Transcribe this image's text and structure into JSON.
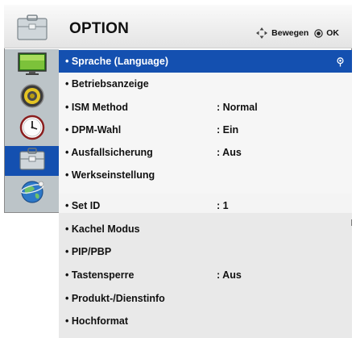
{
  "header": {
    "title": "OPTION",
    "move_label": "Bewegen",
    "ok_label": "OK"
  },
  "sidebar": {
    "items": [
      {
        "icon": "picture-icon",
        "active": false
      },
      {
        "icon": "speaker-icon",
        "active": false
      },
      {
        "icon": "clock-icon",
        "active": false
      },
      {
        "icon": "toolbox-icon",
        "active": true
      },
      {
        "icon": "network-globe-icon",
        "active": false
      }
    ]
  },
  "menu": {
    "items": [
      {
        "label": "• Sprache (Language)",
        "value": "",
        "selected": true
      },
      {
        "label": "• Betriebsanzeige",
        "value": ""
      },
      {
        "label": "• ISM Method",
        "value": ": Normal"
      },
      {
        "label": "• DPM-Wahl",
        "value": ": Ein"
      },
      {
        "label": "• Ausfallsicherung",
        "value": ": Aus"
      },
      {
        "label": "• Werkseinstellung",
        "value": ""
      },
      {
        "label": "• Set ID",
        "value": ": 1"
      },
      {
        "label": "• Kachel Modus",
        "value": ""
      },
      {
        "label": "• PIP/PBP",
        "value": ""
      },
      {
        "label": "• Tastensperre",
        "value": ": Aus"
      },
      {
        "label": "• Produkt-/Dienstinfo",
        "value": ""
      },
      {
        "label": "• Hochformat",
        "value": ""
      }
    ]
  },
  "colors": {
    "selection": "#1450b0",
    "sidebar": "#bcc4c8"
  }
}
